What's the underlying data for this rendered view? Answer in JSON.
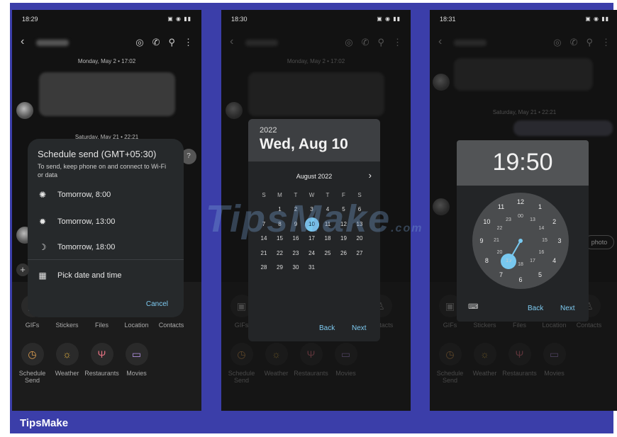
{
  "brand": "TipsMake",
  "watermark": {
    "main": "TipsMake",
    "suffix": ".com"
  },
  "phones": [
    {
      "time": "18:29",
      "date_top": "Monday, May 2 • 17:02",
      "date_mid": "Saturday, May 21 • 22:21"
    },
    {
      "time": "18:30",
      "date_top": "Monday, May 2 • 17:02"
    },
    {
      "time": "18:31",
      "date_mid": "Saturday, May 21 • 22:21"
    }
  ],
  "attach": {
    "row1": [
      "GIFs",
      "Stickers",
      "Files",
      "Location",
      "Contacts"
    ],
    "row2": [
      "Schedule Send",
      "Weather",
      "Restaurants",
      "Movies"
    ]
  },
  "schedule": {
    "title": "Schedule send (GMT+05:30)",
    "subtitle": "To send, keep phone on and connect to Wi-Fi or data",
    "options": [
      "Tomorrow, 8:00",
      "Tomorrow, 13:00",
      "Tomorrow, 18:00"
    ],
    "pick": "Pick date and time",
    "cancel": "Cancel"
  },
  "calendar": {
    "year": "2022",
    "date": "Wed, Aug 10",
    "month": "August 2022",
    "weekdays": [
      "S",
      "M",
      "T",
      "W",
      "T",
      "F",
      "S"
    ],
    "selected": 10,
    "back": "Back",
    "next": "Next"
  },
  "clock": {
    "time": "19:50",
    "selected": "19",
    "outer": [
      "12",
      "1",
      "2",
      "3",
      "4",
      "5",
      "6",
      "7",
      "8",
      "9",
      "10",
      "11"
    ],
    "inner": [
      "00",
      "13",
      "14",
      "15",
      "16",
      "17",
      "18",
      "19",
      "20",
      "21",
      "22",
      "23"
    ],
    "back": "Back",
    "next": "Next"
  },
  "other": {
    "photo": "photo",
    "question": "?"
  }
}
